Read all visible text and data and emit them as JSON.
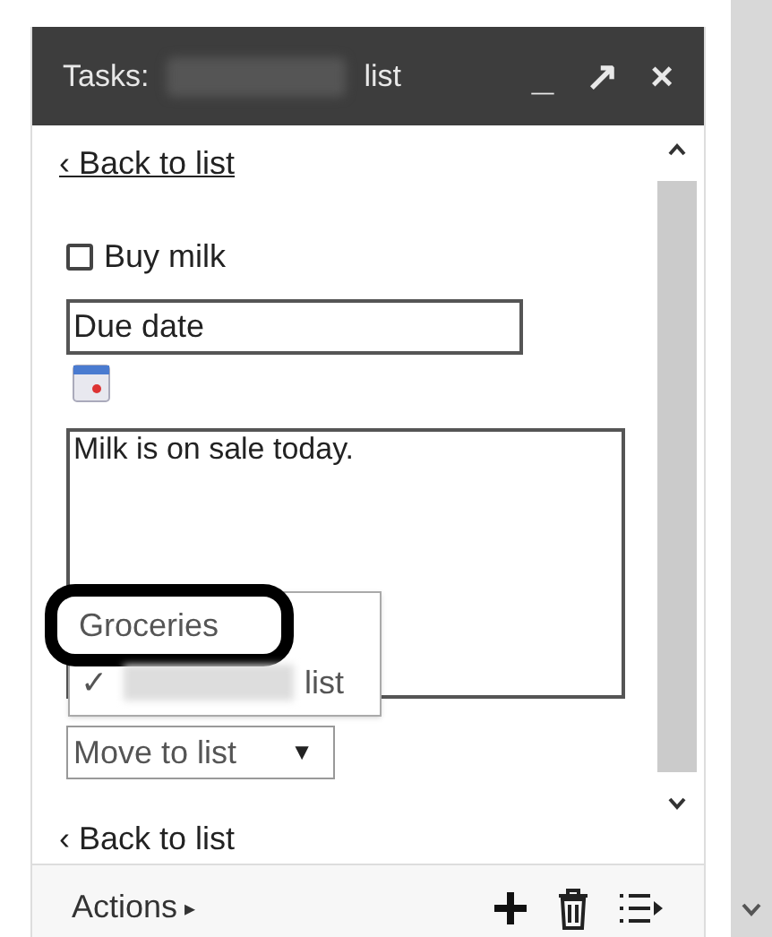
{
  "window": {
    "title_prefix": "Tasks:",
    "title_suffix": "list",
    "controls": [
      "_",
      "↗",
      "×"
    ]
  },
  "back_link_top": "‹ Back to list",
  "task": {
    "title": "Buy milk",
    "checked": false
  },
  "due_date": {
    "placeholder": "Due date"
  },
  "notes": {
    "value": "Milk is on sale today."
  },
  "move_menu": {
    "items": [
      {
        "label": "Groceries",
        "selected": false,
        "highlighted": true
      },
      {
        "label": "list",
        "mark": "✓",
        "selected": true,
        "highlighted": false
      }
    ]
  },
  "move_dropdown": {
    "label": "Move to list",
    "caret": "▼"
  },
  "back_link_bottom": "‹ Back to list",
  "footer": {
    "actions": "Actions",
    "actions_caret": "▸"
  }
}
